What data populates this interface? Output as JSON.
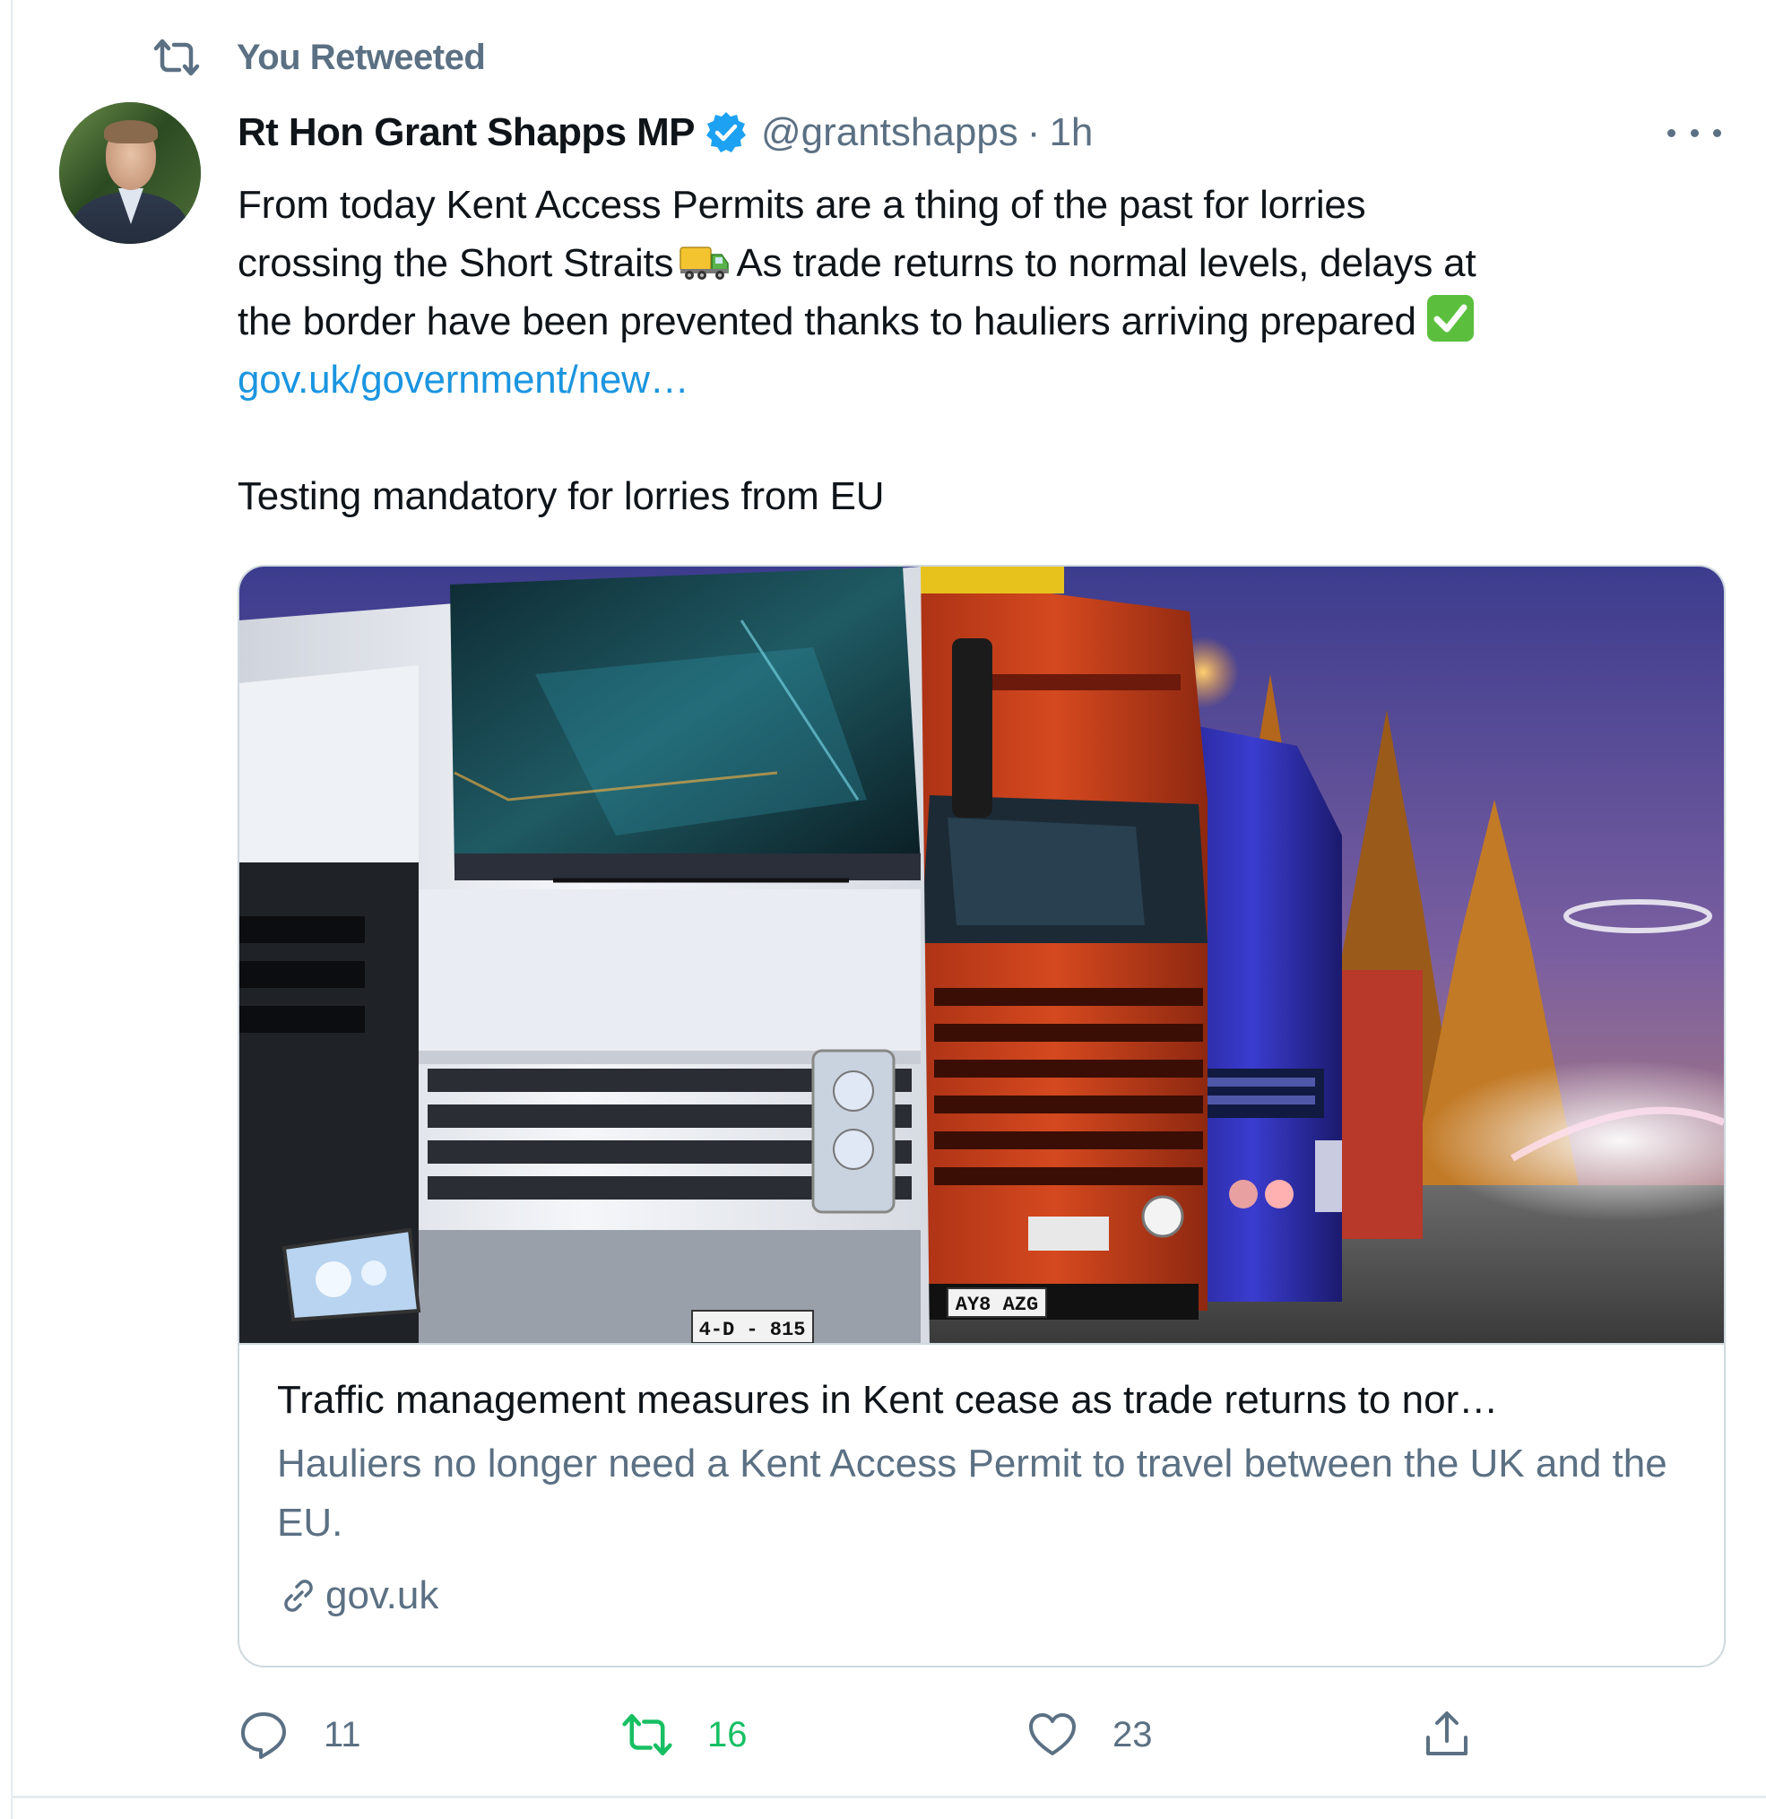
{
  "social_context": {
    "label": "You Retweeted"
  },
  "author": {
    "name": "Rt Hon Grant Shapps MP",
    "handle": "@grantshapps",
    "separator": "·",
    "time": "1h",
    "verified_icon": "verified-badge-icon"
  },
  "tweet": {
    "line1": "From today Kent Access Permits are a thing of the past for lorries",
    "line2_a": "crossing the Short Straits",
    "line2_b": "As trade returns to normal levels, delays at",
    "line3": "the border have been prevented thanks to hauliers arriving prepared",
    "link": "gov.uk/government/new…",
    "line5": "Testing mandatory for lorries from EU",
    "emoji_1": "delivery-truck-emoji",
    "emoji_2": "check-mark-emoji"
  },
  "card": {
    "image_icon": "lorries-photo",
    "plate_1": "4-D - 815",
    "plate_2": "AY8 AZG",
    "title": "Traffic management measures in Kent cease as trade returns to nor…",
    "description": "Hauliers no longer need a Kent Access Permit to travel between the UK and the EU.",
    "domain": "gov.uk"
  },
  "actions": {
    "reply_count": "11",
    "retweet_count": "16",
    "like_count": "23",
    "reply_icon": "reply-icon",
    "retweet_icon": "retweet-icon",
    "like_icon": "heart-icon",
    "share_icon": "share-icon"
  },
  "colors": {
    "text_primary": "#0f1419",
    "text_secondary": "#5b7083",
    "link": "#1b95e0",
    "retweet_active": "#17bf63",
    "verified": "#1da1f2",
    "border": "#cfd9de"
  }
}
